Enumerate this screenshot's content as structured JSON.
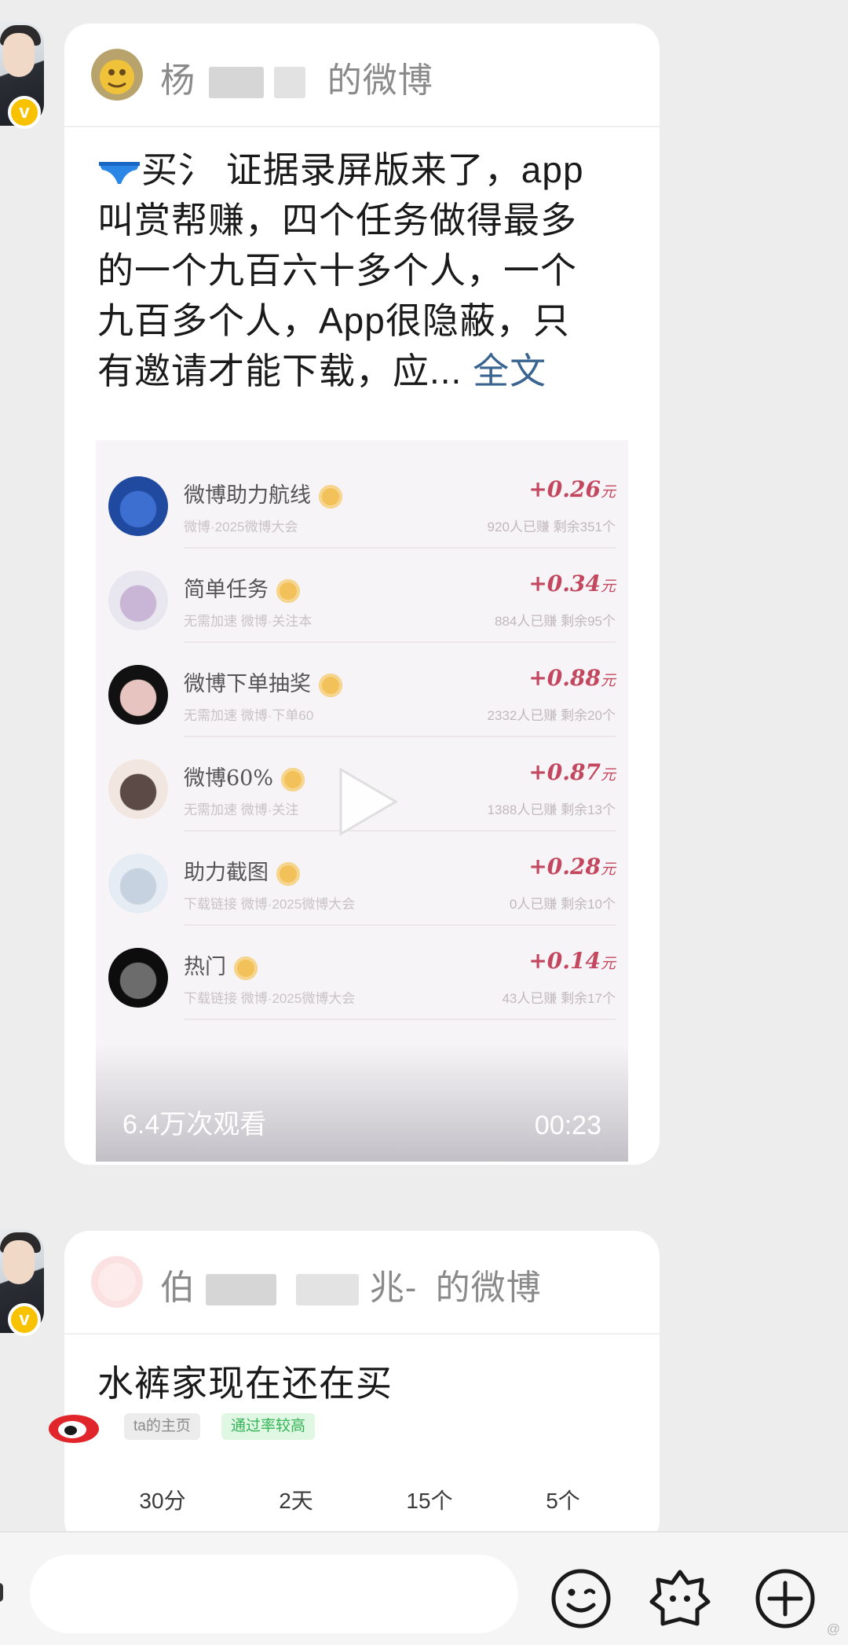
{
  "messages": [
    {
      "source_name_prefix": "杨",
      "source_name_suffix": "的微博",
      "post_text_lines": [
        "买氵 证据录屏版来了，app",
        "叫赏帮赚，四个任务做得最多",
        "的一个九百六十多个人，一个",
        "九百多个人，App很隐蔽，只",
        "有邀请才能下载，应..."
      ],
      "full_text_link": "全文",
      "video": {
        "views": "6.4万次观看",
        "duration": "00:23",
        "rows": [
          {
            "title": "微博助力航线",
            "price": "+0.26",
            "unit": "元",
            "sub_left": "微博·2025微博大会",
            "sub_right": "920人已赚  剩余351个"
          },
          {
            "title": "简单任务",
            "price": "+0.34",
            "unit": "元",
            "sub_left": "无需加速   微博·关注本",
            "sub_right": "884人已赚  剩余95个"
          },
          {
            "title": "微博下单抽奖",
            "price": "+0.88",
            "unit": "元",
            "sub_left": "无需加速   微博·下单60",
            "sub_right": "2332人已赚  剩余20个"
          },
          {
            "title": "微博60%",
            "price": "+0.87",
            "unit": "元",
            "sub_left": "无需加速   微博·关注",
            "sub_right": "1388人已赚  剩余13个"
          },
          {
            "title": "助力截图",
            "price": "+0.28",
            "unit": "元",
            "sub_left": "下载链接   微博·2025微博大会",
            "sub_right": "0人已赚  剩余10个"
          },
          {
            "title": "热门",
            "price": "+0.14",
            "unit": "元",
            "sub_left": "下载链接   微博·2025微博大会",
            "sub_right": "43人已赚  剩余17个"
          }
        ]
      }
    },
    {
      "source_name_prefix": "伯",
      "source_name_mid": "兆-",
      "source_name_suffix": "的微博",
      "post_text_lines": [
        "水裤家现在还在买"
      ],
      "tags": {
        "home": "ta的主页",
        "rate": "通过率较高"
      },
      "stats": [
        "30分",
        "2天",
        "15个",
        "5个"
      ]
    }
  ],
  "input_bar": {
    "icons": [
      "emoji-icon",
      "sticker-icon",
      "add-icon"
    ]
  },
  "watermark": "@"
}
